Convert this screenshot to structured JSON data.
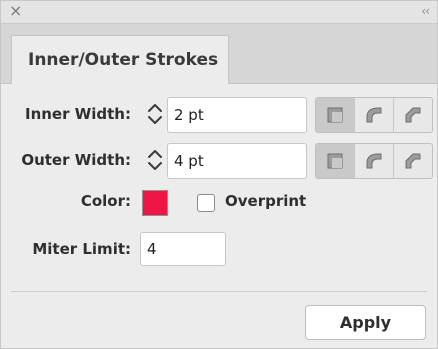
{
  "titlebar": {
    "close_glyph": "×",
    "collapse_glyph": "‹‹"
  },
  "tab": {
    "label": "Inner/Outer Strokes"
  },
  "inner": {
    "label": "Inner Width:",
    "value": "2 pt",
    "join_buttons": [
      "miter-join-icon",
      "round-join-icon",
      "bevel-join-icon"
    ],
    "active_join": 0
  },
  "outer": {
    "label": "Outer Width:",
    "value": "4 pt",
    "join_buttons": [
      "miter-join-icon",
      "round-join-icon",
      "bevel-join-icon"
    ],
    "active_join": 0
  },
  "color": {
    "label": "Color:",
    "value": "#ee1644"
  },
  "overprint": {
    "label": "Overprint",
    "checked": false
  },
  "miter": {
    "label": "Miter Limit:",
    "value": "4"
  },
  "apply": {
    "label": "Apply"
  }
}
